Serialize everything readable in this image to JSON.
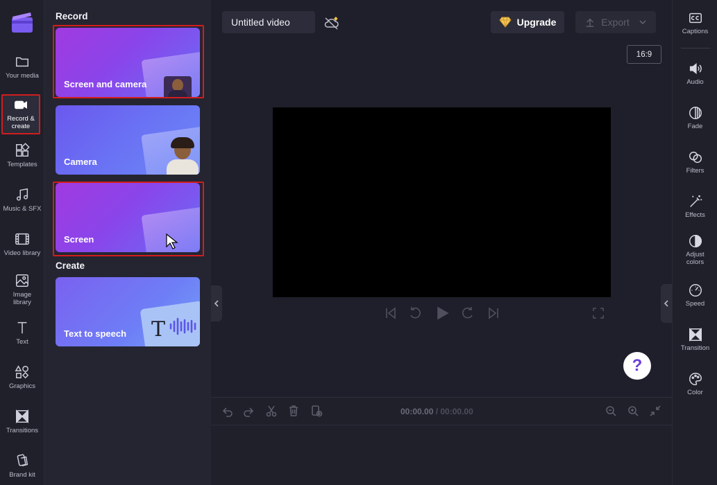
{
  "left_nav": {
    "items": [
      {
        "label": "Your media",
        "icon": "folder-icon"
      },
      {
        "label": "Record & create",
        "icon": "video-camera-icon"
      },
      {
        "label": "Templates",
        "icon": "templates-icon"
      },
      {
        "label": "Music & SFX",
        "icon": "music-icon"
      },
      {
        "label": "Video library",
        "icon": "film-icon"
      },
      {
        "label": "Image library",
        "icon": "image-icon"
      },
      {
        "label": "Text",
        "icon": "text-icon"
      },
      {
        "label": "Graphics",
        "icon": "shapes-icon"
      },
      {
        "label": "Transitions",
        "icon": "transition-icon"
      },
      {
        "label": "Brand kit",
        "icon": "brand-kit-icon"
      }
    ]
  },
  "panel": {
    "record_heading": "Record",
    "create_heading": "Create",
    "cards": [
      {
        "label": "Screen and camera"
      },
      {
        "label": "Camera"
      },
      {
        "label": "Screen"
      },
      {
        "label": "Text to speech"
      }
    ]
  },
  "topbar": {
    "project_title": "Untitled video",
    "upgrade_label": "Upgrade",
    "export_label": "Export",
    "aspect_ratio": "16:9"
  },
  "timeline": {
    "current_time": "00:00.00",
    "total_time": "/ 00:00.00"
  },
  "help": {
    "label": "?"
  },
  "right_sidebar": {
    "items": [
      {
        "label": "Captions",
        "icon": "captions-icon"
      },
      {
        "label": "Audio",
        "icon": "speaker-icon"
      },
      {
        "label": "Fade",
        "icon": "fade-icon"
      },
      {
        "label": "Filters",
        "icon": "filters-icon"
      },
      {
        "label": "Effects",
        "icon": "magic-wand-icon"
      },
      {
        "label": "Adjust colors",
        "icon": "contrast-icon"
      },
      {
        "label": "Speed",
        "icon": "speedometer-icon"
      },
      {
        "label": "Transition",
        "icon": "transition-icon"
      },
      {
        "label": "Color",
        "icon": "palette-icon"
      }
    ]
  },
  "colors": {
    "accent_purple": "#8a45ea",
    "highlight_red": "#d21d1d",
    "background": "#1f1f2b"
  }
}
